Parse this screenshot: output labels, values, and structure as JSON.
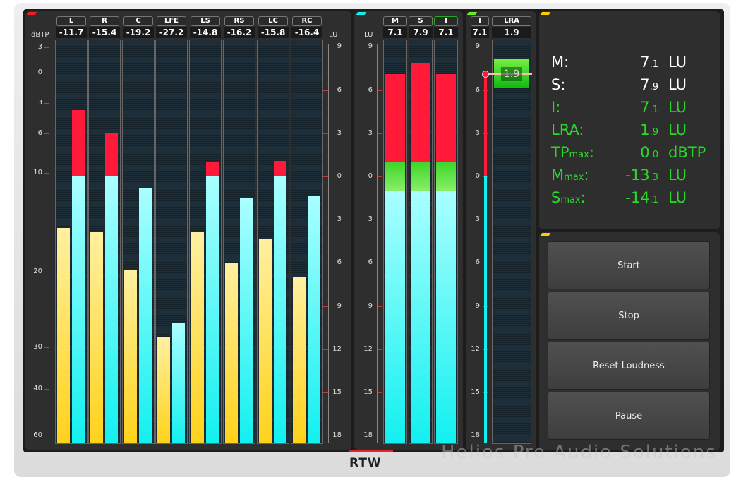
{
  "channels": {
    "unit_left": "dBTP",
    "unit_right": "LU",
    "dbtp_ticks": [
      "3",
      "0",
      "3",
      "6",
      "10",
      "20",
      "30",
      "40",
      "60"
    ],
    "lu_ticks": [
      "9",
      "6",
      "3",
      "0",
      "3",
      "6",
      "9",
      "12",
      "15",
      "18"
    ],
    "items": [
      {
        "label": "L",
        "readout": "-11.7",
        "peak_dbtp": -15.6,
        "loudness_lu": 4.6
      },
      {
        "label": "R",
        "readout": "-15.4",
        "peak_dbtp": -16.0,
        "loudness_lu": 3.0
      },
      {
        "label": "C",
        "readout": "-19.2",
        "peak_dbtp": -19.8,
        "loudness_lu": -0.8
      },
      {
        "label": "LFE",
        "readout": "-27.2",
        "peak_dbtp": -28.7,
        "loudness_lu": -10.2
      },
      {
        "label": "LS",
        "readout": "-14.8",
        "peak_dbtp": -16.0,
        "loudness_lu": 1.0
      },
      {
        "label": "RS",
        "readout": "-16.2",
        "peak_dbtp": -19.1,
        "loudness_lu": -1.5
      },
      {
        "label": "LC",
        "readout": "-15.8",
        "peak_dbtp": -16.7,
        "loudness_lu": 1.1
      },
      {
        "label": "RC",
        "readout": "-16.4",
        "peak_dbtp": -20.7,
        "loudness_lu": -1.3
      }
    ]
  },
  "loudness": {
    "unit": "LU",
    "ticks": [
      "9",
      "6",
      "3",
      "0",
      "3",
      "6",
      "9",
      "12",
      "15",
      "18"
    ],
    "items": [
      {
        "label": "M",
        "readout": "7.1",
        "value_lu": 7.1
      },
      {
        "label": "S",
        "readout": "7.9",
        "value_lu": 7.9
      },
      {
        "label": "I",
        "readout": "7.1",
        "value_lu": 7.1
      }
    ]
  },
  "lra": {
    "i_label": "I",
    "i_readout": "7.1",
    "i_value_lu": 7.1,
    "lra_label": "LRA",
    "lra_readout": "1.9",
    "box_label": "1.9",
    "ticks": [
      "9",
      "6",
      "3",
      "0",
      "3",
      "6",
      "9",
      "12",
      "15",
      "18"
    ]
  },
  "summary": [
    {
      "label": "M:",
      "int": "7",
      "dec": ".1",
      "unit": "LU",
      "color": "white"
    },
    {
      "label": "S:",
      "int": "7",
      "dec": ".9",
      "unit": "LU",
      "color": "white"
    },
    {
      "label": "I:",
      "int": "7",
      "dec": ".1",
      "unit": "LU",
      "color": "green"
    },
    {
      "label": "LRA:",
      "int": "1",
      "dec": ".9",
      "unit": "LU",
      "color": "green"
    },
    {
      "label": "TP",
      "sub": "max",
      "colon": ":",
      "int": "0",
      "dec": ".0",
      "unit": "dBTP",
      "color": "green"
    },
    {
      "label": "M",
      "sub": "max",
      "colon": ":",
      "int": "-13",
      "dec": ".3",
      "unit": "LU",
      "color": "green"
    },
    {
      "label": "S",
      "sub": "max",
      "colon": ":",
      "int": "-14",
      "dec": ".1",
      "unit": "LU",
      "color": "green"
    }
  ],
  "buttons": {
    "start": "Start",
    "stop": "Stop",
    "reset": "Reset Loudness",
    "pause": "Pause"
  },
  "branding": {
    "logo": "RTW",
    "watermark": "Helios Pro Audio Solutions"
  },
  "colors": {
    "peak": "#ffd21a",
    "loudness": "#13f0f0",
    "over": "#ff1a3a",
    "target": "#3fd62a",
    "green_text": "#2ad82a"
  }
}
